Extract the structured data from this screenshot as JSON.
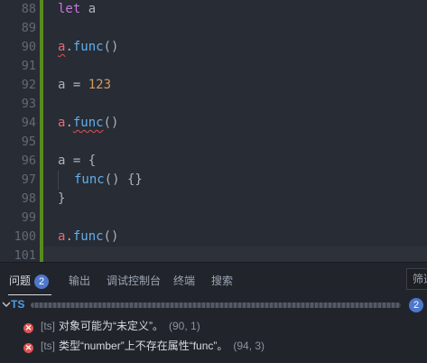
{
  "editor": {
    "lines": [
      {
        "n": "88",
        "tokens": [
          {
            "t": "let",
            "c": "kw"
          },
          {
            "t": " ",
            "c": "pun"
          },
          {
            "t": "a",
            "c": "pun"
          }
        ]
      },
      {
        "n": "89",
        "tokens": []
      },
      {
        "n": "90",
        "tokens": [
          {
            "t": "a",
            "c": "var squig"
          },
          {
            "t": ".",
            "c": "pun"
          },
          {
            "t": "func",
            "c": "fn"
          },
          {
            "t": "()",
            "c": "pun"
          }
        ]
      },
      {
        "n": "91",
        "tokens": []
      },
      {
        "n": "92",
        "tokens": [
          {
            "t": "a",
            "c": "pun"
          },
          {
            "t": " = ",
            "c": "pun"
          },
          {
            "t": "123",
            "c": "num"
          }
        ]
      },
      {
        "n": "93",
        "tokens": []
      },
      {
        "n": "94",
        "tokens": [
          {
            "t": "a",
            "c": "var"
          },
          {
            "t": ".",
            "c": "pun"
          },
          {
            "t": "func",
            "c": "fn squig"
          },
          {
            "t": "()",
            "c": "pun"
          }
        ]
      },
      {
        "n": "95",
        "tokens": []
      },
      {
        "n": "96",
        "tokens": [
          {
            "t": "a",
            "c": "pun"
          },
          {
            "t": " = {",
            "c": "pun"
          }
        ]
      },
      {
        "n": "97",
        "indent": true,
        "tokens": [
          {
            "t": "func",
            "c": "fn"
          },
          {
            "t": "() {}",
            "c": "pun"
          }
        ]
      },
      {
        "n": "98",
        "tokens": [
          {
            "t": "}",
            "c": "pun"
          }
        ]
      },
      {
        "n": "99",
        "tokens": []
      },
      {
        "n": "100",
        "tokens": [
          {
            "t": "a",
            "c": "var"
          },
          {
            "t": ".",
            "c": "pun"
          },
          {
            "t": "func",
            "c": "fn"
          },
          {
            "t": "()",
            "c": "pun"
          }
        ]
      },
      {
        "n": "101",
        "tokens": []
      }
    ]
  },
  "panel": {
    "tabs": [
      {
        "label": "问题",
        "badge": "2",
        "active": true
      },
      {
        "label": "输出"
      },
      {
        "label": "调试控制台"
      },
      {
        "label": "终端"
      },
      {
        "label": "搜索"
      }
    ],
    "filter_placeholder": "筛选",
    "file_group": {
      "lang": "TS",
      "count": "2"
    },
    "problems": [
      {
        "icon": "error-icon",
        "source": "[ts]",
        "message": "对象可能为“未定义”。",
        "location": "(90, 1)"
      },
      {
        "icon": "error-icon",
        "source": "[ts]",
        "message": "类型“number”上不存在属性“func”。",
        "location": "(94, 3)"
      }
    ]
  },
  "colors": {
    "background": "#282c34",
    "keyword": "#c678dd",
    "function": "#61afef",
    "variable": "#e06c75",
    "number": "#d19a66",
    "error": "#e05252",
    "badge": "#4d78cc",
    "gutter_modified": "#5a8a1e"
  }
}
